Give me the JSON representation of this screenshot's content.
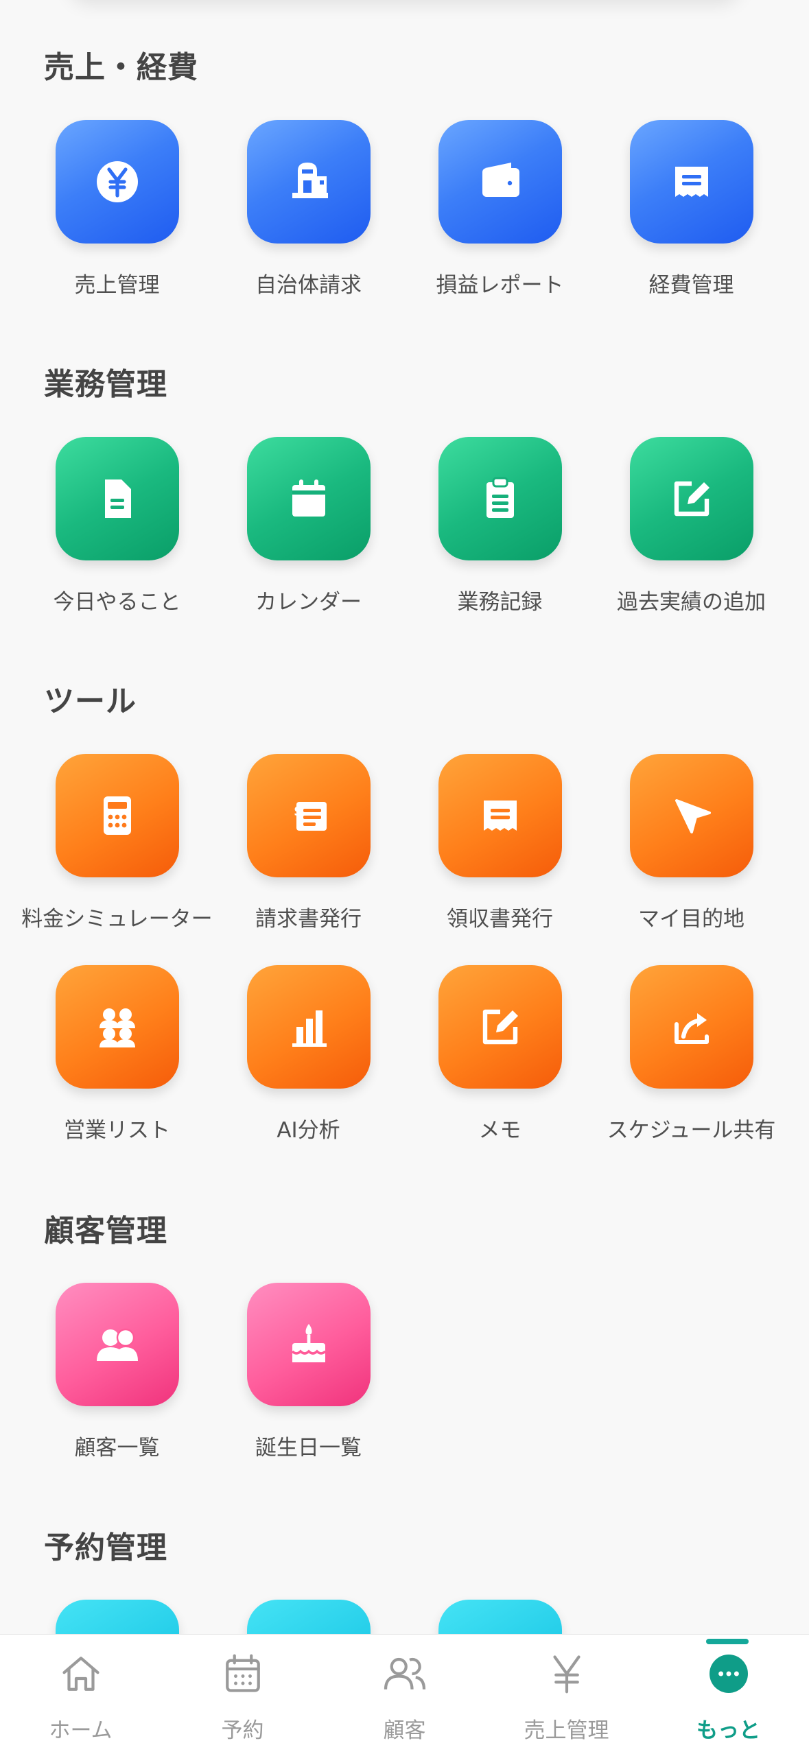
{
  "sections": [
    {
      "title": "売上・経費",
      "items": [
        {
          "label": "売上管理",
          "icon": "yen-coin-icon"
        },
        {
          "label": "自治体請求",
          "icon": "city-hall-icon"
        },
        {
          "label": "損益レポート",
          "icon": "wallet-icon"
        },
        {
          "label": "経費管理",
          "icon": "receipt-icon"
        }
      ]
    },
    {
      "title": "業務管理",
      "items": [
        {
          "label": "今日やること",
          "icon": "document-icon"
        },
        {
          "label": "カレンダー",
          "icon": "calendar-icon"
        },
        {
          "label": "業務記録",
          "icon": "clipboard-icon"
        },
        {
          "label": "過去実績の追加",
          "icon": "edit-icon"
        }
      ]
    },
    {
      "title": "ツール",
      "items": [
        {
          "label": "料金シミュレーター",
          "icon": "calculator-icon"
        },
        {
          "label": "請求書発行",
          "icon": "invoice-icon"
        },
        {
          "label": "領収書発行",
          "icon": "receipt-icon"
        },
        {
          "label": "マイ目的地",
          "icon": "navigation-arrow-icon"
        },
        {
          "label": "営業リスト",
          "icon": "people-group-icon"
        },
        {
          "label": "AI分析",
          "icon": "bar-chart-icon"
        },
        {
          "label": "メモ",
          "icon": "edit-icon"
        },
        {
          "label": "スケジュール共有",
          "icon": "share-icon"
        }
      ]
    },
    {
      "title": "顧客管理",
      "items": [
        {
          "label": "顧客一覧",
          "icon": "people-icon"
        },
        {
          "label": "誕生日一覧",
          "icon": "cake-icon"
        }
      ]
    },
    {
      "title": "予約管理",
      "items": []
    }
  ],
  "tabbar": [
    {
      "label": "ホーム",
      "icon": "home-icon"
    },
    {
      "label": "予約",
      "icon": "calendar-icon"
    },
    {
      "label": "顧客",
      "icon": "people-icon"
    },
    {
      "label": "売上管理",
      "icon": "yen-icon"
    },
    {
      "label": "もっと",
      "icon": "more-icon",
      "active": true
    }
  ],
  "colors": {
    "sales": "#2f6ff5",
    "business": "#16b07a",
    "tools": "#ff7a1a",
    "customers": "#ff5a98",
    "reservations": "#22cce8",
    "active_tab": "#0f9d88",
    "inactive_tab": "#9a9a9a"
  }
}
